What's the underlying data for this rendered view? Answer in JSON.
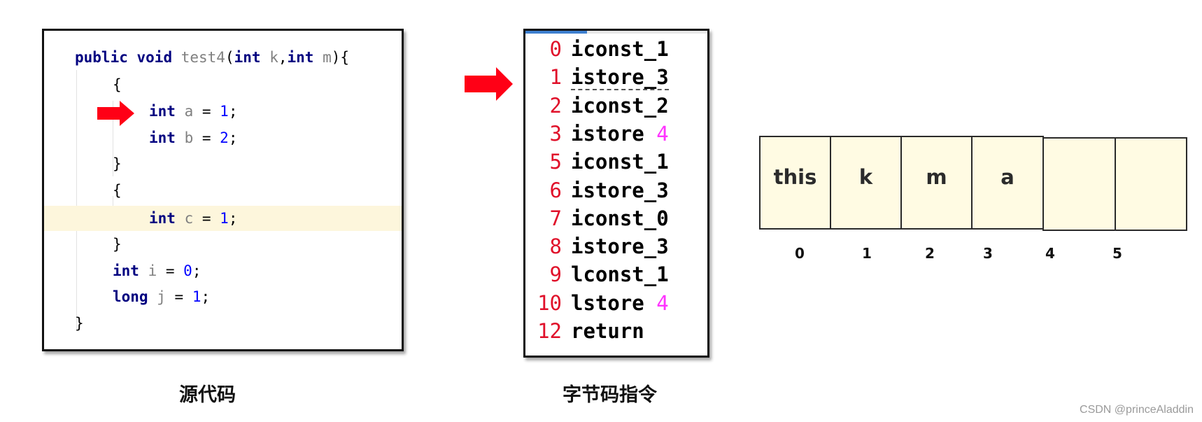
{
  "source_panel": {
    "caption": "源代码",
    "lines": [
      {
        "tokens": [
          {
            "t": "public ",
            "c": "kw"
          },
          {
            "t": "void ",
            "c": "kw"
          },
          {
            "t": "test4",
            "c": "nm"
          },
          {
            "t": "(",
            "c": "pl"
          },
          {
            "t": "int ",
            "c": "kw"
          },
          {
            "t": "k",
            "c": "nm"
          },
          {
            "t": ",",
            "c": "pl"
          },
          {
            "t": "int ",
            "c": "kw"
          },
          {
            "t": "m",
            "c": "nm"
          },
          {
            "t": "){",
            "c": "pl"
          }
        ],
        "indent": 0
      },
      {
        "tokens": [
          {
            "t": "{",
            "c": "pl"
          }
        ],
        "indent": 1
      },
      {
        "tokens": [
          {
            "t": "int ",
            "c": "kw"
          },
          {
            "t": "a",
            "c": "nm"
          },
          {
            "t": " = ",
            "c": "pl"
          },
          {
            "t": "1",
            "c": "num"
          },
          {
            "t": ";",
            "c": "pl"
          }
        ],
        "indent": 2,
        "pointer": true
      },
      {
        "tokens": [
          {
            "t": "int ",
            "c": "kw"
          },
          {
            "t": "b",
            "c": "nm"
          },
          {
            "t": " = ",
            "c": "pl"
          },
          {
            "t": "2",
            "c": "num"
          },
          {
            "t": ";",
            "c": "pl"
          }
        ],
        "indent": 2
      },
      {
        "tokens": [
          {
            "t": "}",
            "c": "pl"
          }
        ],
        "indent": 1
      },
      {
        "tokens": [
          {
            "t": "{",
            "c": "pl"
          }
        ],
        "indent": 1
      },
      {
        "tokens": [
          {
            "t": "int ",
            "c": "kw"
          },
          {
            "t": "c",
            "c": "nm"
          },
          {
            "t": " = ",
            "c": "pl"
          },
          {
            "t": "1",
            "c": "num"
          },
          {
            "t": ";",
            "c": "pl"
          }
        ],
        "indent": 2,
        "highlighted": true
      },
      {
        "tokens": [
          {
            "t": "}",
            "c": "pl"
          }
        ],
        "indent": 1
      },
      {
        "tokens": [
          {
            "t": "int ",
            "c": "kw"
          },
          {
            "t": "i",
            "c": "nm"
          },
          {
            "t": " = ",
            "c": "pl"
          },
          {
            "t": "0",
            "c": "num"
          },
          {
            "t": ";",
            "c": "pl"
          }
        ],
        "indent": 1
      },
      {
        "tokens": [
          {
            "t": "long ",
            "c": "kw"
          },
          {
            "t": "j",
            "c": "nm"
          },
          {
            "t": " = ",
            "c": "pl"
          },
          {
            "t": "1",
            "c": "num"
          },
          {
            "t": ";",
            "c": "pl"
          }
        ],
        "indent": 1
      },
      {
        "tokens": [
          {
            "t": "}",
            "c": "pl"
          }
        ],
        "indent": 0
      }
    ]
  },
  "bytecode_panel": {
    "caption": "字节码指令",
    "instructions": [
      {
        "offset": "0",
        "op": "iconst_1",
        "arg": ""
      },
      {
        "offset": "1",
        "op": "istore_3",
        "arg": "",
        "pointer": true
      },
      {
        "offset": "2",
        "op": "iconst_2",
        "arg": ""
      },
      {
        "offset": "3",
        "op": "istore",
        "arg": "4"
      },
      {
        "offset": "5",
        "op": "iconst_1",
        "arg": ""
      },
      {
        "offset": "6",
        "op": "istore_3",
        "arg": ""
      },
      {
        "offset": "7",
        "op": "iconst_0",
        "arg": ""
      },
      {
        "offset": "8",
        "op": "istore_3",
        "arg": ""
      },
      {
        "offset": "9",
        "op": "lconst_1",
        "arg": ""
      },
      {
        "offset": "10",
        "op": "lstore",
        "arg": "4"
      },
      {
        "offset": "12",
        "op": "return",
        "arg": ""
      }
    ]
  },
  "local_variable_table": {
    "slots": [
      {
        "index": "0",
        "name": "this"
      },
      {
        "index": "1",
        "name": "k"
      },
      {
        "index": "2",
        "name": "m"
      },
      {
        "index": "3",
        "name": "a"
      },
      {
        "index": "4",
        "name": ""
      },
      {
        "index": "5",
        "name": ""
      }
    ]
  },
  "colors": {
    "arrow": "#ff0016",
    "keyword": "#000080",
    "identifier": "#808080",
    "number": "#0000ff",
    "offset": "#e0102a",
    "operand": "#ff33ff",
    "slot_fill": "#fffbe3",
    "line_highlight": "#fdf6dc"
  },
  "watermark": "CSDN @princeAladdin"
}
